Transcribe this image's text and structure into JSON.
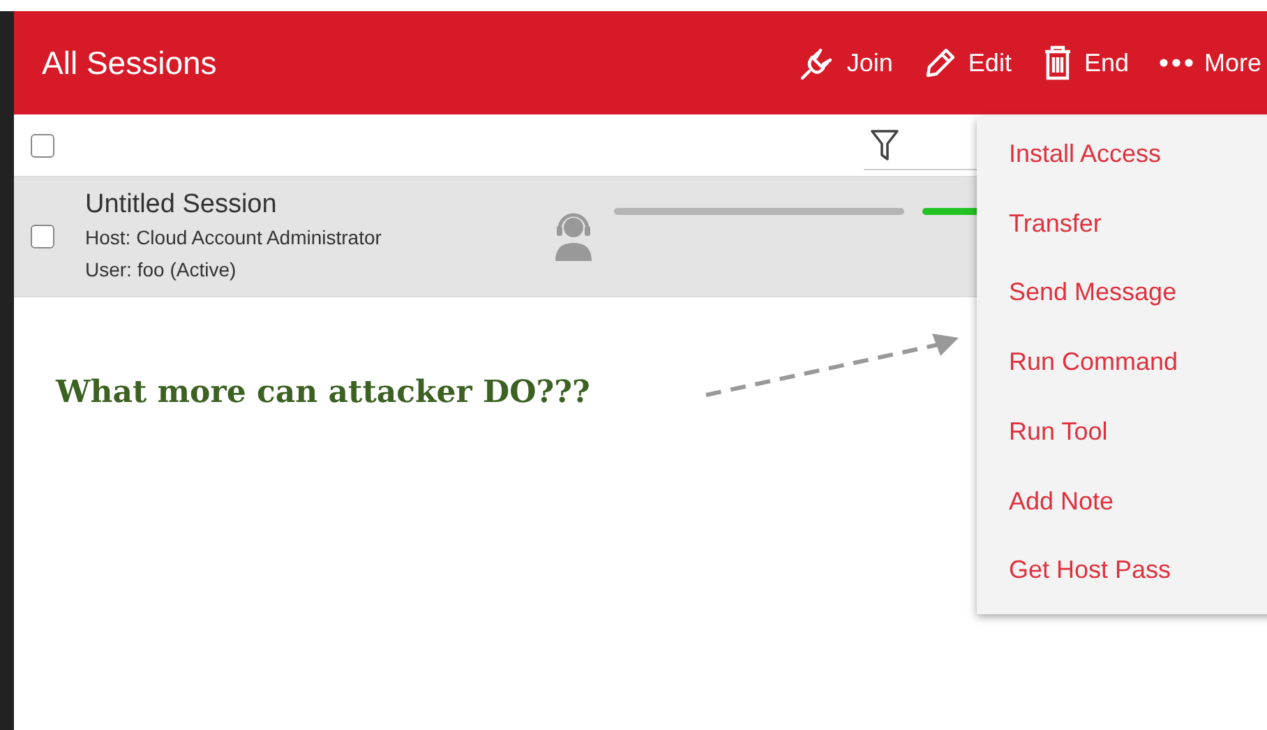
{
  "header": {
    "title": "All Sessions",
    "actions": [
      {
        "kind": "join",
        "label": "Join"
      },
      {
        "kind": "edit",
        "label": "Edit"
      },
      {
        "kind": "end",
        "label": "End"
      },
      {
        "kind": "more",
        "label": "More"
      }
    ]
  },
  "toolbar": {
    "select_all": {
      "checked": false
    }
  },
  "sessions": [
    {
      "name": "Untitled Session",
      "host": "Host: Cloud Account Administrator",
      "user": "User: foo (Active)",
      "checked": false
    }
  ],
  "annotation": "What more can attacker DO???",
  "menu": {
    "items": [
      "Install Access",
      "Transfer",
      "Send Message",
      "Run Command",
      "Run Tool",
      "Add Note",
      "Get Host Pass"
    ]
  }
}
